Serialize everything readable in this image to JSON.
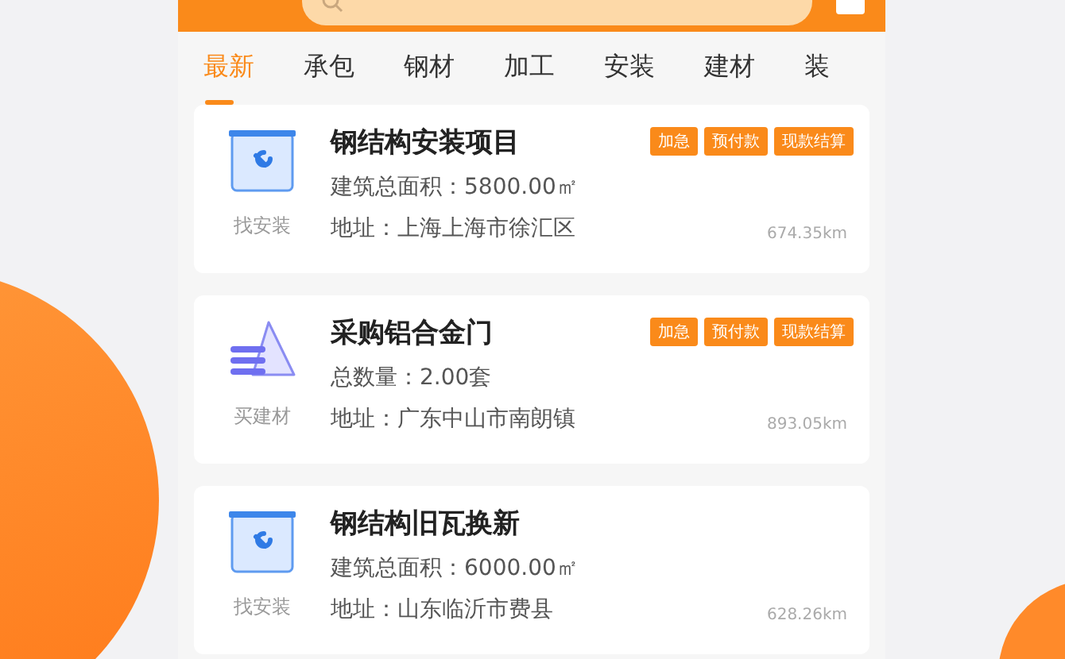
{
  "tabs": [
    {
      "label": "最新",
      "selected": true
    },
    {
      "label": "承包",
      "selected": false
    },
    {
      "label": "钢材",
      "selected": false
    },
    {
      "label": "加工",
      "selected": false
    },
    {
      "label": "安装",
      "selected": false
    },
    {
      "label": "建材",
      "selected": false
    },
    {
      "label": "装",
      "selected": false
    }
  ],
  "cards": [
    {
      "kind": "install",
      "category": "找安装",
      "title": "钢结构安装项目",
      "detail": "建筑总面积：5800.00㎡",
      "address": "地址：上海上海市徐汇区",
      "distance": "674.35km",
      "tags": [
        "加急",
        "预付款",
        "现款结算"
      ]
    },
    {
      "kind": "material",
      "category": "买建材",
      "title": "采购铝合金门",
      "detail": "总数量：2.00套",
      "address": "地址：广东中山市南朗镇",
      "distance": "893.05km",
      "tags": [
        "加急",
        "预付款",
        "现款结算"
      ]
    },
    {
      "kind": "install",
      "category": "找安装",
      "title": "钢结构旧瓦换新",
      "detail": "建筑总面积：6000.00㎡",
      "address": "地址：山东临沂市费县",
      "distance": "628.26km"
    }
  ]
}
